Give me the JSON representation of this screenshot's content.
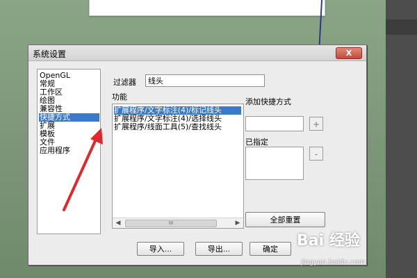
{
  "dialog": {
    "title": "系统设置",
    "close_label": "X"
  },
  "categories": [
    {
      "label": "OpenGL",
      "selected": false
    },
    {
      "label": "常规",
      "selected": false
    },
    {
      "label": "工作区",
      "selected": false
    },
    {
      "label": "绘图",
      "selected": false
    },
    {
      "label": "兼容性",
      "selected": false
    },
    {
      "label": "快捷方式",
      "selected": true
    },
    {
      "label": "扩展",
      "selected": false
    },
    {
      "label": "模板",
      "selected": false
    },
    {
      "label": "文件",
      "selected": false
    },
    {
      "label": "应用程序",
      "selected": false
    }
  ],
  "filter": {
    "label": "过滤器",
    "value": "线头"
  },
  "functions": {
    "label": "功能",
    "items": [
      {
        "label": "扩展程序/文字标注(4)/标记线头",
        "selected": true
      },
      {
        "label": "扩展程序/文字标注(4)/选择线头",
        "selected": false
      },
      {
        "label": "扩展程序/线面工具(5)/查找线头",
        "selected": false
      }
    ],
    "scroll_thumb": "III"
  },
  "shortcut": {
    "add_label": "添加快捷方式",
    "add_button": "+",
    "assigned_label": "已指定",
    "remove_button": "-",
    "reset_all": "全部重置"
  },
  "footer": {
    "import": "导入...",
    "export": "导出...",
    "ok": "确定"
  },
  "watermark": {
    "logo": "Bai 经验",
    "url": "jingyan.baidu.com"
  },
  "colors": {
    "selection": "#3b79cc",
    "arrow": "#e0282a"
  }
}
